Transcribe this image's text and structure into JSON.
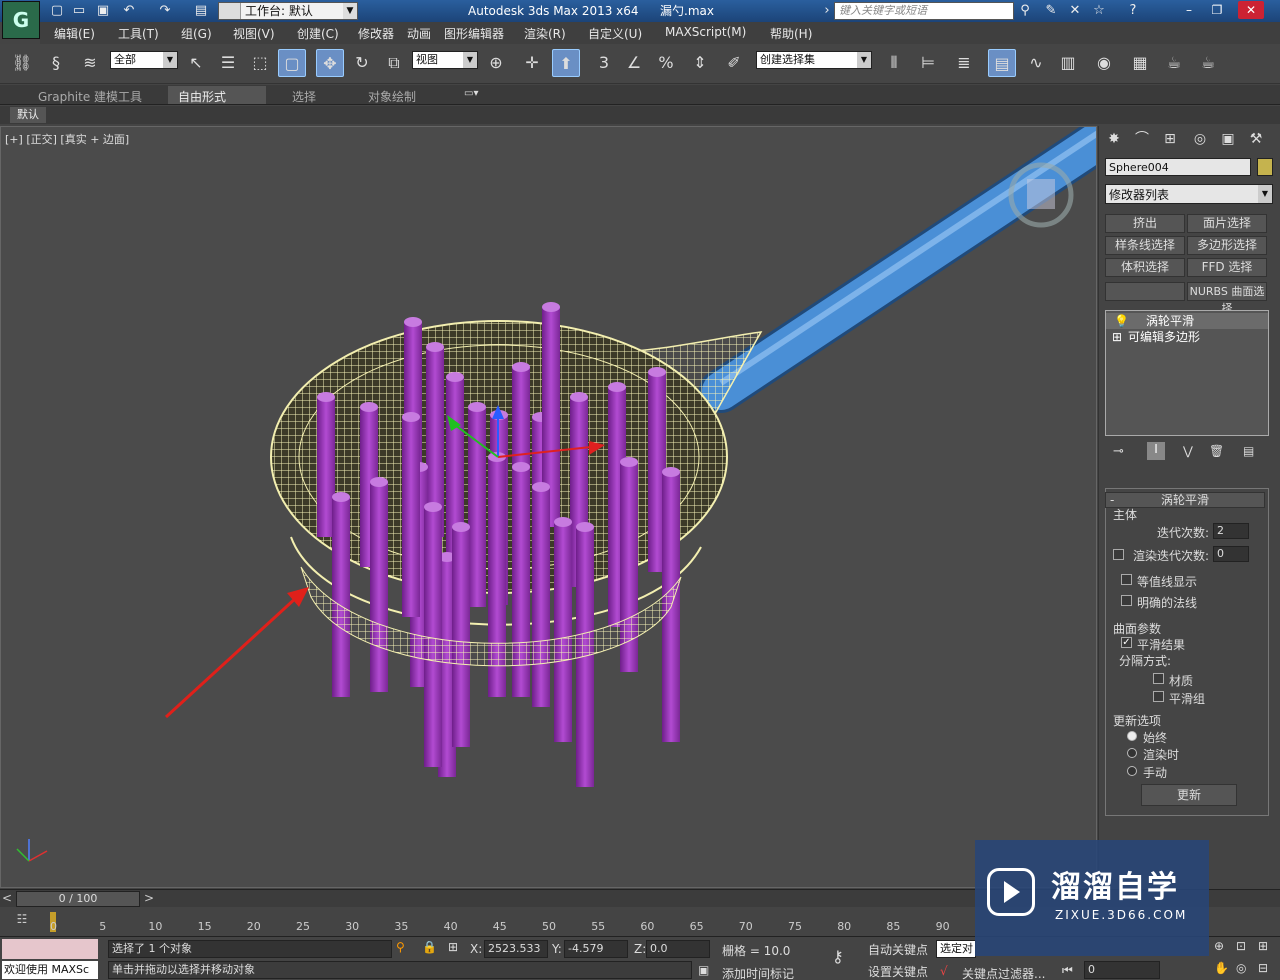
{
  "title_bar": {
    "workspace_label": "工作台: 默认",
    "app_name": "Autodesk 3ds Max  2013 x64",
    "file_name": "漏勺.max",
    "search_placeholder": "键入关键字或短语"
  },
  "menu": [
    "编辑(E)",
    "工具(T)",
    "组(G)",
    "视图(V)",
    "创建(C)",
    "修改器",
    "动画",
    "图形编辑器",
    "渲染(R)",
    "自定义(U)",
    "MAXScript(M)",
    "帮助(H)"
  ],
  "toolbar": {
    "selection_filter": "全部",
    "ref_coord": "视图",
    "snap_3": "3",
    "snap_percent": "%",
    "named_selection": "创建选择集"
  },
  "ribbon": {
    "tabs": [
      "Graphite 建模工具",
      "自由形式",
      "选择",
      "对象绘制"
    ],
    "active_tab": "自由形式",
    "sub_label": "默认"
  },
  "viewport": {
    "label_plus": "[+]",
    "label_view": "[正交]",
    "label_shading": "[真实 + 边面]"
  },
  "command_panel": {
    "object_name": "Sphere004",
    "modifier_list": "修改器列表",
    "mod_buttons": [
      "挤出",
      "面片选择",
      "样条线选择",
      "多边形选择",
      "体积选择",
      "FFD 选择",
      "",
      "NURBS 曲面选择"
    ],
    "stack": [
      "涡轮平滑",
      "可编辑多边形"
    ],
    "rollout": {
      "title": "涡轮平滑",
      "main_group": "主体",
      "iterations_label": "迭代次数:",
      "iterations_value": "2",
      "render_iters_label": "渲染迭代次数:",
      "render_iters_value": "0",
      "isoline": "等值线显示",
      "explicit_normals": "明确的法线",
      "surface_group": "曲面参数",
      "smooth_result": "平滑结果",
      "separate_by": "分隔方式:",
      "materials": "材质",
      "smoothing_groups": "平滑组",
      "update_group": "更新选项",
      "always": "始终",
      "when_rendering": "渲染时",
      "manually": "手动",
      "update_button": "更新"
    }
  },
  "timeline": {
    "slider": "0 / 100",
    "ticks": [
      "0",
      "5",
      "10",
      "15",
      "20",
      "25",
      "30",
      "35",
      "40",
      "45",
      "50",
      "55",
      "60",
      "65",
      "70",
      "75",
      "80",
      "85",
      "90"
    ]
  },
  "status": {
    "welcome": "欢迎使用 MAXSc",
    "selected": "选择了 1 个对象",
    "hint": "单击并拖动以选择并移动对象",
    "x_label": "X:",
    "x": "2523.533",
    "y_label": "Y:",
    "y": "-4.579",
    "z_label": "Z:",
    "z": "0.0",
    "grid": "栅格 = 10.0",
    "add_time_tag": "添加时间标记",
    "auto_key": "自动关键点",
    "set_key": "设置关键点",
    "selected_obj": "选定对",
    "key_filters": "关键点过滤器...",
    "frame": "0"
  },
  "watermark": {
    "brand": "溜溜自学",
    "url": "ZIXUE.3D66.COM"
  },
  "colors": {
    "handle": "#4a8fd6",
    "mesh": "#f3efb0",
    "bars": "#a13fbf",
    "arrow": "#e0201a"
  }
}
